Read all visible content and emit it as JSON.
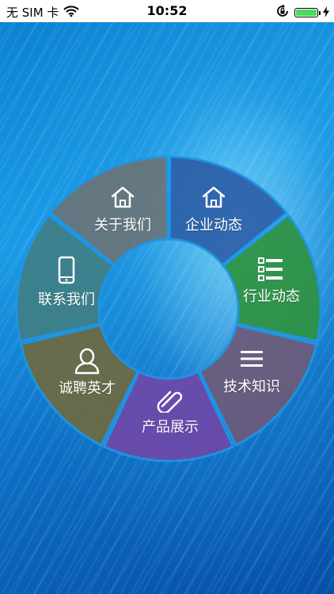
{
  "status_bar": {
    "carrier": "无 SIM 卡",
    "time": "10:52",
    "battery_level": 1.0,
    "battery_color": "#4cd964"
  },
  "menu": {
    "items": [
      {
        "id": "company-news",
        "label": "企业动态",
        "icon": "home-icon",
        "color": "#2d5fa8"
      },
      {
        "id": "industry-news",
        "label": "行业动态",
        "icon": "list-icon",
        "color": "#2e9140"
      },
      {
        "id": "tech-knowledge",
        "label": "技术知识",
        "icon": "menu-icon",
        "color": "#6d5a78"
      },
      {
        "id": "product-showcase",
        "label": "产品展示",
        "icon": "paperclip-icon",
        "color": "#6e48a8"
      },
      {
        "id": "recruitment",
        "label": "诚聘英才",
        "icon": "user-icon",
        "color": "#6e6a40"
      },
      {
        "id": "contact-us",
        "label": "联系我们",
        "icon": "phone-icon",
        "color": "#3f7f86"
      },
      {
        "id": "about-us",
        "label": "关于我们",
        "icon": "home-icon",
        "color": "#6a7478"
      }
    ]
  }
}
